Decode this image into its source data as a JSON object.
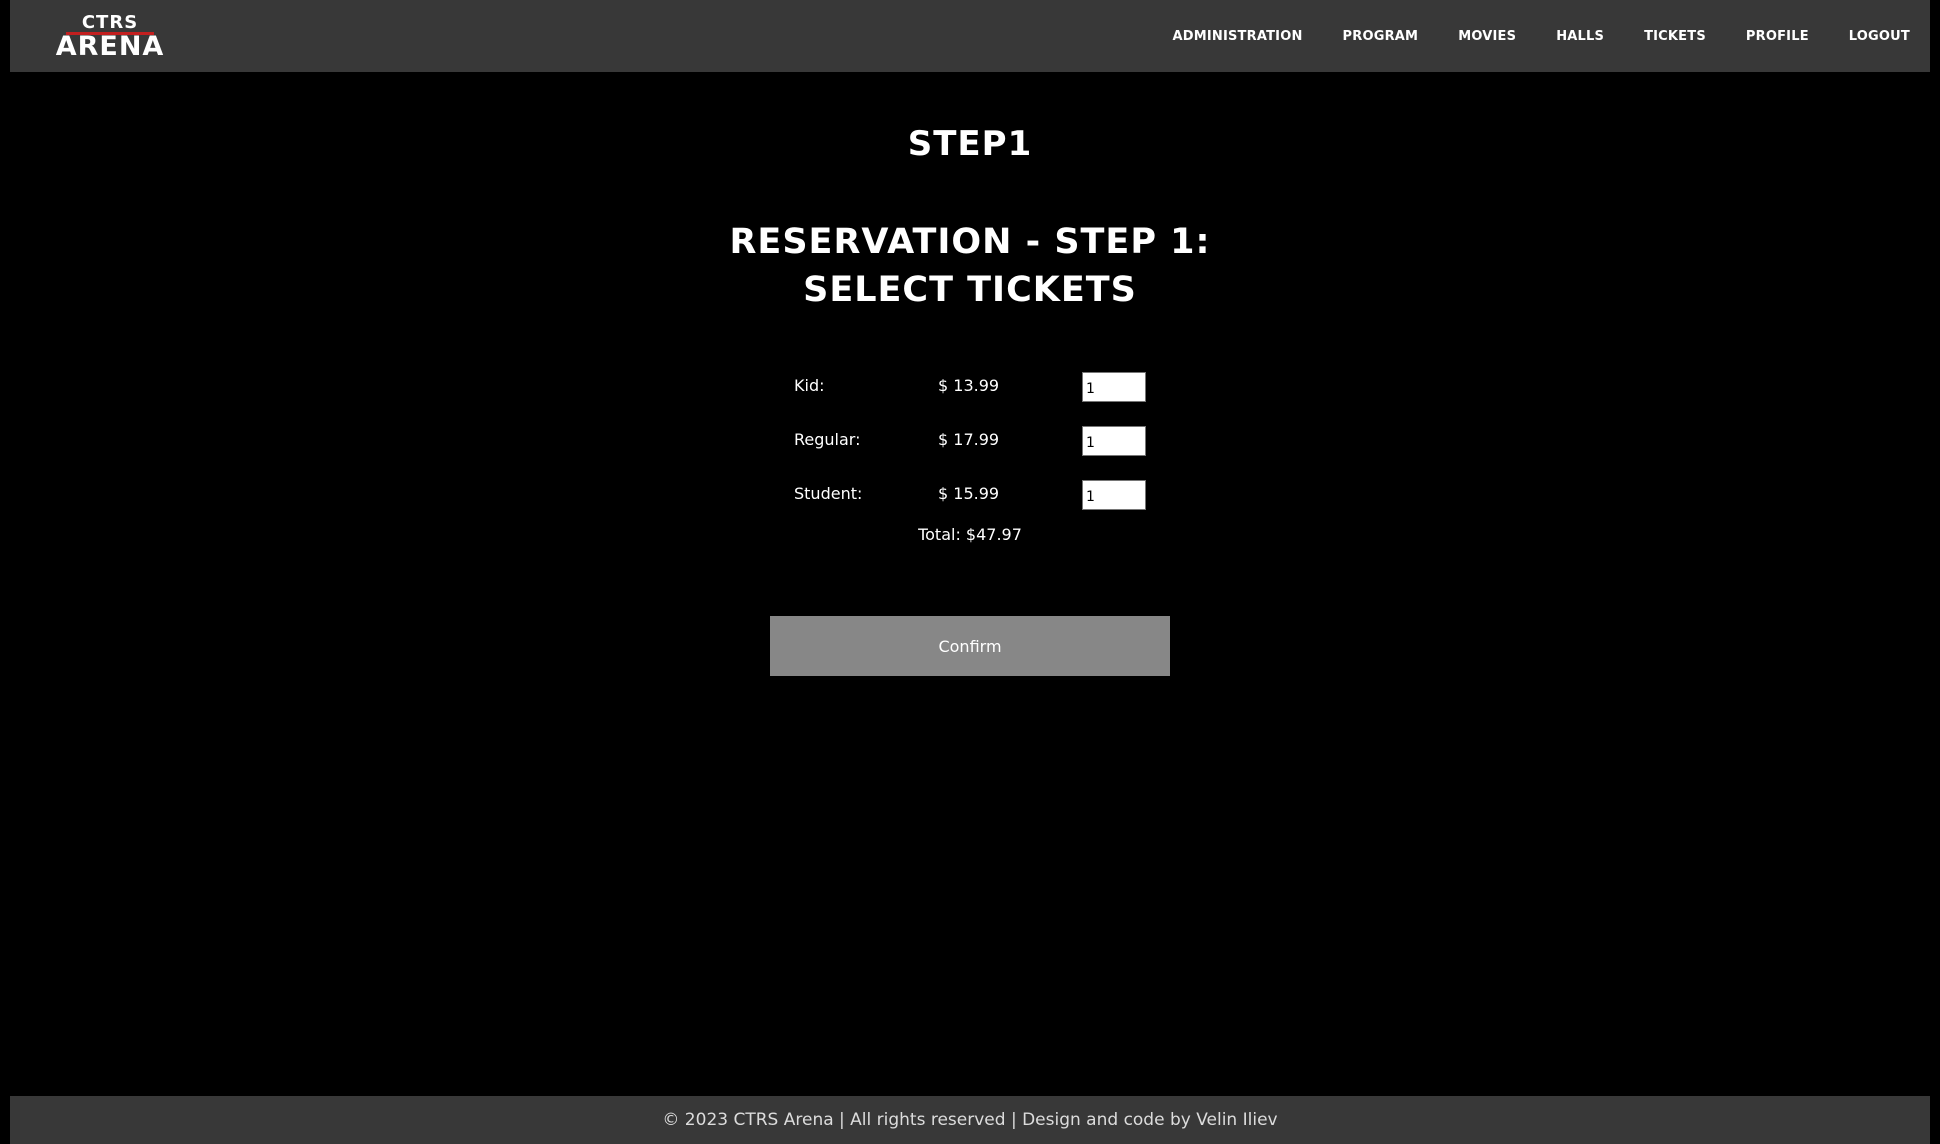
{
  "brand": {
    "top": "CTRS",
    "bottom": "ARENA"
  },
  "nav": {
    "items": [
      "ADMINISTRATION",
      "PROGRAM",
      "MOVIES",
      "HALLS",
      "TICKETS",
      "PROFILE",
      "LOGOUT"
    ]
  },
  "main": {
    "step_title": "STEP1",
    "reservation_title_line1": "RESERVATION - STEP 1:",
    "reservation_title_line2": "SELECT TICKETS",
    "tickets": [
      {
        "label": "Kid:",
        "price": "$ 13.99",
        "quantity": "1"
      },
      {
        "label": "Regular:",
        "price": "$ 17.99",
        "quantity": "1"
      },
      {
        "label": "Student:",
        "price": "$ 15.99",
        "quantity": "1"
      }
    ],
    "total": "Total: $47.97",
    "confirm_label": "Confirm"
  },
  "footer": {
    "text": "© 2023 CTRS Arena | All rights reserved | Design and code by Velin Iliev"
  },
  "colors": {
    "background": "#000000",
    "header_bg": "#383838",
    "logo_accent": "#c21f1f",
    "button_bg": "#878787"
  }
}
